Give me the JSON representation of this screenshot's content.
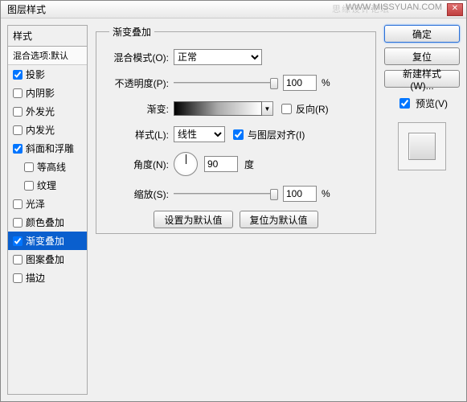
{
  "window": {
    "title": "图层样式"
  },
  "watermark": {
    "line1": "思缘设计论坛",
    "line2": "WWW.MISSYUAN.COM"
  },
  "styles": {
    "header": "样式",
    "subheader": "混合选项:默认",
    "items": [
      {
        "label": "投影",
        "checked": true,
        "indent": false
      },
      {
        "label": "内阴影",
        "checked": false,
        "indent": false
      },
      {
        "label": "外发光",
        "checked": false,
        "indent": false
      },
      {
        "label": "内发光",
        "checked": false,
        "indent": false
      },
      {
        "label": "斜面和浮雕",
        "checked": true,
        "indent": false
      },
      {
        "label": "等高线",
        "checked": false,
        "indent": true
      },
      {
        "label": "纹理",
        "checked": false,
        "indent": true
      },
      {
        "label": "光泽",
        "checked": false,
        "indent": false
      },
      {
        "label": "颜色叠加",
        "checked": false,
        "indent": false
      },
      {
        "label": "渐变叠加",
        "checked": true,
        "indent": false,
        "selected": true
      },
      {
        "label": "图案叠加",
        "checked": false,
        "indent": false
      },
      {
        "label": "描边",
        "checked": false,
        "indent": false
      }
    ]
  },
  "panel": {
    "legend": "渐变叠加",
    "blend_mode_label": "混合模式(O):",
    "blend_mode_value": "正常",
    "opacity_label": "不透明度(P):",
    "opacity_value": "100",
    "percent": "%",
    "gradient_label": "渐变:",
    "reverse_label": "反向(R)",
    "reverse_checked": false,
    "style_label": "样式(L):",
    "style_value": "线性",
    "align_label": "与图层对齐(I)",
    "align_checked": true,
    "angle_label": "角度(N):",
    "angle_value": "90",
    "angle_unit": "度",
    "scale_label": "缩放(S):",
    "scale_value": "100",
    "set_default": "设置为默认值",
    "reset_default": "复位为默认值"
  },
  "buttons": {
    "ok": "确定",
    "cancel": "复位",
    "new_style": "新建样式(W)...",
    "preview": "预览(V)"
  }
}
